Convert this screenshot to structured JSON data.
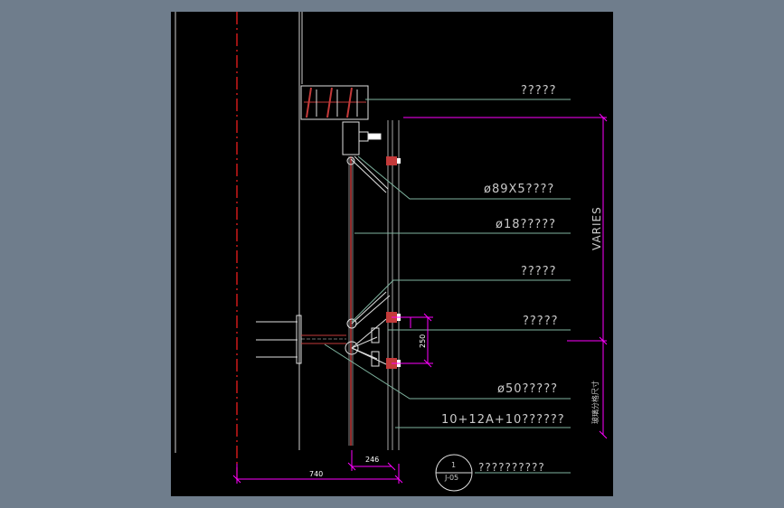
{
  "colors": {
    "background": "#6f7d8c",
    "canvas": "#000000",
    "leader": "#7fb5a0",
    "dimension": "#ff00ff",
    "centerline": "#ff2020",
    "glass": "#8a8a8a",
    "hatch": "#c43a3a",
    "text": "#c9c9c9"
  },
  "labels": {
    "top_beam": "?????",
    "tube": "ø89X5????",
    "rod": "ø18?????",
    "upper_node": "?????",
    "spider": "?????",
    "lower_tube": "ø50?????",
    "glass": "10+12A+10??????",
    "detail_title": "??????????"
  },
  "dimensions": {
    "varies": "VARIES",
    "module_note": "玻璃分格尺寸",
    "spider_spacing": "250",
    "dim_246": "246",
    "dim_740": "740"
  },
  "detail_marker": {
    "number": "1",
    "sheet": "J-05"
  }
}
